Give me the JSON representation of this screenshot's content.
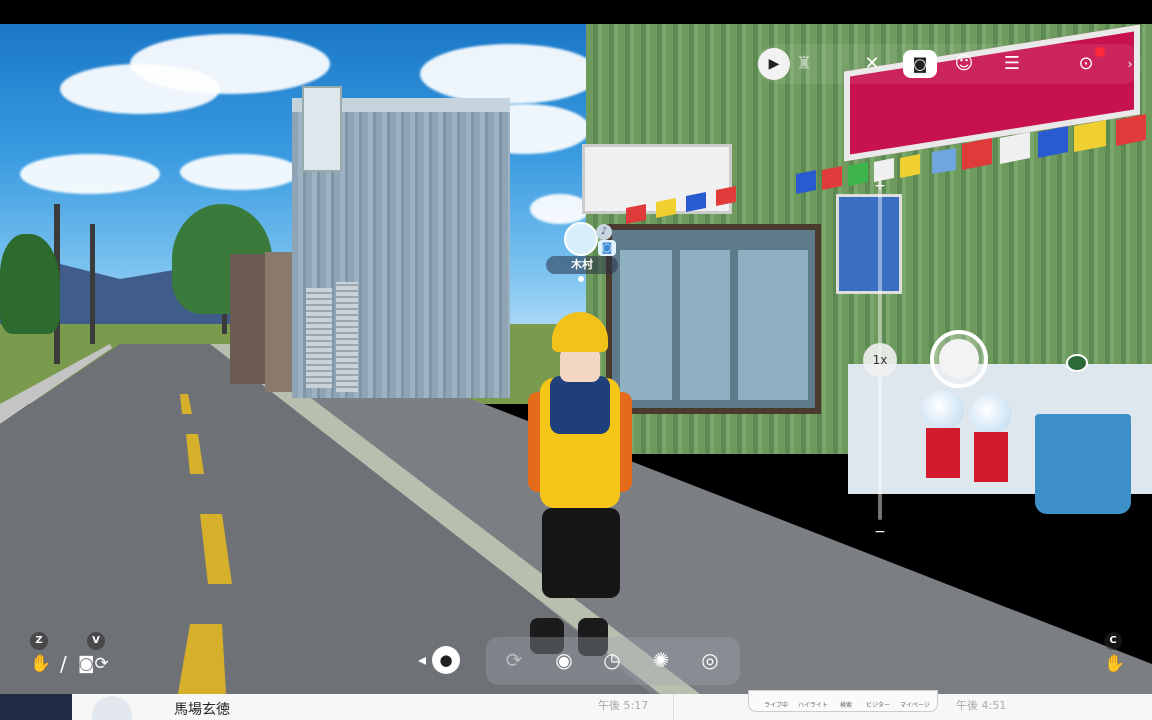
{
  "player": {
    "name": "木村"
  },
  "camera": {
    "zoom_label": "1x"
  },
  "toolbar": {
    "play_icon": "play-icon",
    "mic_off_icon": "mic-off-icon",
    "camera_icon": "camera-icon",
    "emote_icon": "smile-icon",
    "settings_icon": "sliders-icon",
    "record_icon": "record-icon"
  },
  "shortcuts": {
    "z_key": "Z",
    "v_key": "V",
    "c_key": "C",
    "separator": "/"
  },
  "bottom_controls": [
    {
      "name": "rotate-icon",
      "glyph": "⟳"
    },
    {
      "name": "portrait-icon",
      "glyph": "◉"
    },
    {
      "name": "timer-icon",
      "glyph": "◷"
    },
    {
      "name": "aperture-icon",
      "glyph": "✺"
    },
    {
      "name": "eye-icon",
      "glyph": "◎"
    }
  ],
  "taskbar": {
    "contact_name": "馬場玄徳",
    "time_left": "午後 5:17",
    "time_right": "午後 4:51",
    "tabs": [
      "ライブ中",
      "ハイライト",
      "検索",
      "ビジター",
      "マイページ"
    ]
  },
  "colors": {
    "accent_red": "#ff2a3a",
    "jacket_yellow": "#f5c518",
    "jacket_navy": "#1f3f7a",
    "shop_sign": "#c8124f"
  }
}
